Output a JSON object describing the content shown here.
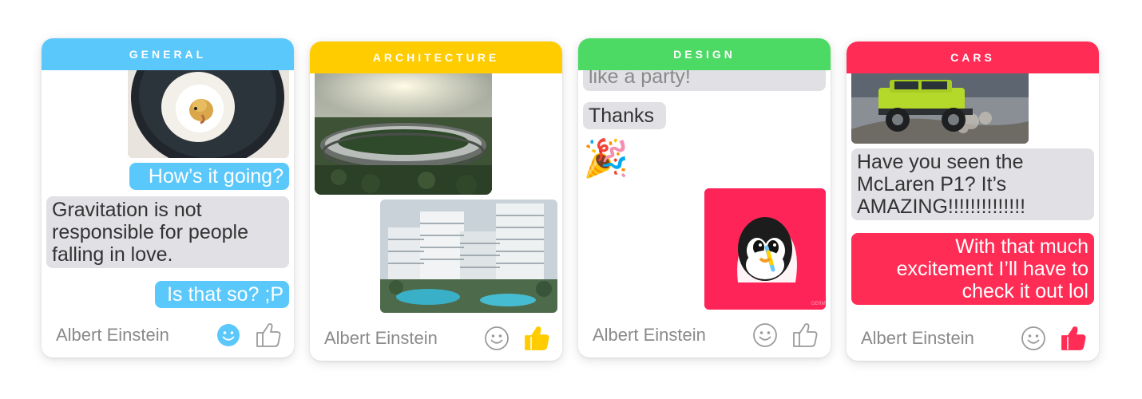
{
  "colors": {
    "general": "#5ac8fa",
    "architecture": "#ffcc00",
    "design": "#4cd964",
    "cars": "#ff2d55",
    "received_bubble": "#e0e0e5",
    "footer_text": "#8a8a8a"
  },
  "cards": [
    {
      "category": "GENERAL",
      "messages": [
        "How’s it going?",
        "Gravitation is not responsible for people falling in love.",
        "Is that so? ;P"
      ],
      "images": [
        "sushi-bird-photo"
      ],
      "footer": {
        "name": "Albert Einstein",
        "emoji_icon": "smiley-icon",
        "like_icon": "thumbs-up-icon"
      }
    },
    {
      "category": "ARCHITECTURE",
      "messages": [],
      "images": [
        "ring-building-photo",
        "apartment-complex-photo"
      ],
      "footer": {
        "name": "Albert Einstein",
        "emoji_icon": "smiley-icon",
        "like_icon": "thumbs-up-icon"
      }
    },
    {
      "category": "DESIGN",
      "messages": [
        "like a party!",
        "Thanks",
        "🎉"
      ],
      "images": [
        "penguin-sticker"
      ],
      "footer": {
        "name": "Albert Einstein",
        "emoji_icon": "smiley-icon",
        "like_icon": "thumbs-up-icon"
      }
    },
    {
      "category": "CARS",
      "messages": [
        "Have you seen the McLaren P1? It’s AMAZING!!!!!!!!!!!!!!",
        "With that much excitement I’ll have to check it out lol"
      ],
      "images": [
        "offroad-suv-photo"
      ],
      "footer": {
        "name": "Albert Einstein",
        "emoji_icon": "smiley-icon",
        "like_icon": "thumbs-up-icon"
      }
    }
  ]
}
